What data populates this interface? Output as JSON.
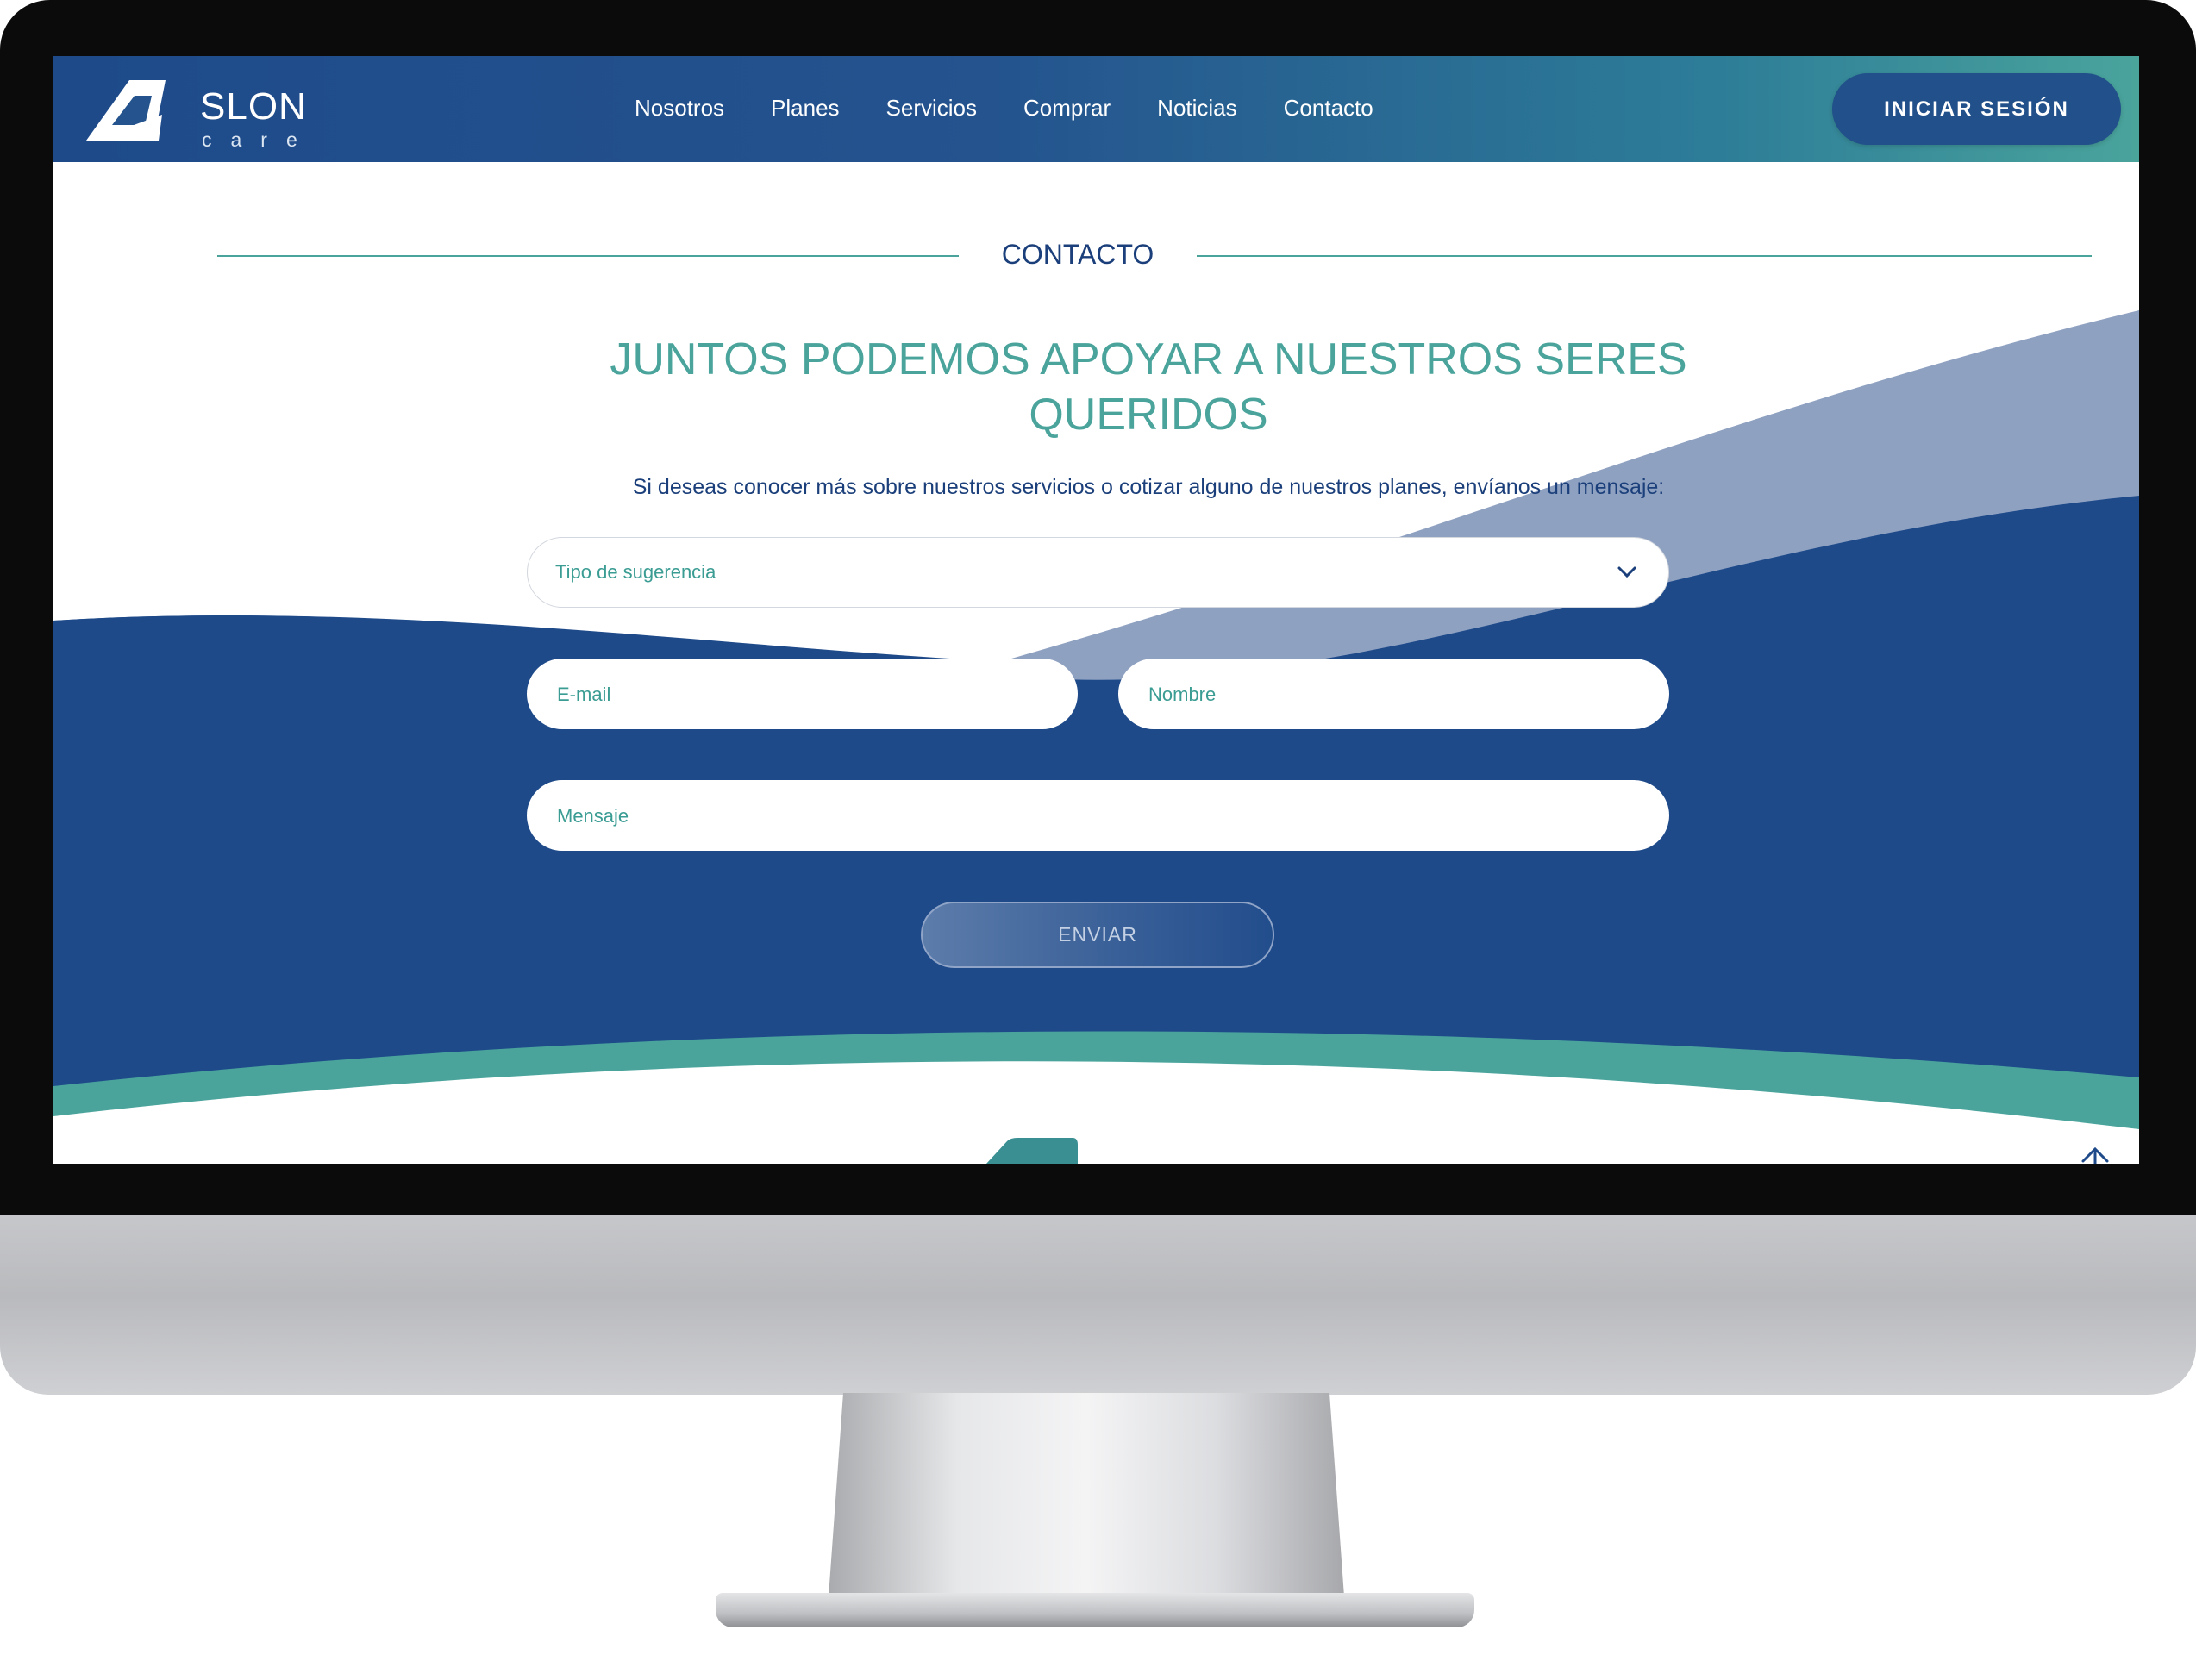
{
  "header": {
    "logo_text": "SLON",
    "logo_subtext": "care",
    "nav": [
      "Nosotros",
      "Planes",
      "Servicios",
      "Comprar",
      "Noticias",
      "Contacto"
    ],
    "login_label": "INICIAR SESIÓN"
  },
  "contact": {
    "section_title": "CONTACTO",
    "headline_line1": "JUNTOS PODEMOS APOYAR A NUESTROS SERES",
    "headline_line2": "QUERIDOS",
    "subtext": "Si deseas conocer más sobre nuestros servicios o cotizar alguno de nuestros planes, envíanos un mensaje:",
    "form": {
      "tipo_placeholder": "Tipo de sugerencia",
      "email_placeholder": "E-mail",
      "nombre_placeholder": "Nombre",
      "mensaje_placeholder": "Mensaje",
      "submit_label": "ENVIAR"
    }
  },
  "colors": {
    "navy": "#1e4a8a",
    "teal": "#4aa49c",
    "light_wave": "#8fa1c1",
    "title_text": "#1b3f7a"
  },
  "icons": [
    "logo-mark-icon",
    "chevron-down-icon",
    "arrow-up-icon"
  ]
}
